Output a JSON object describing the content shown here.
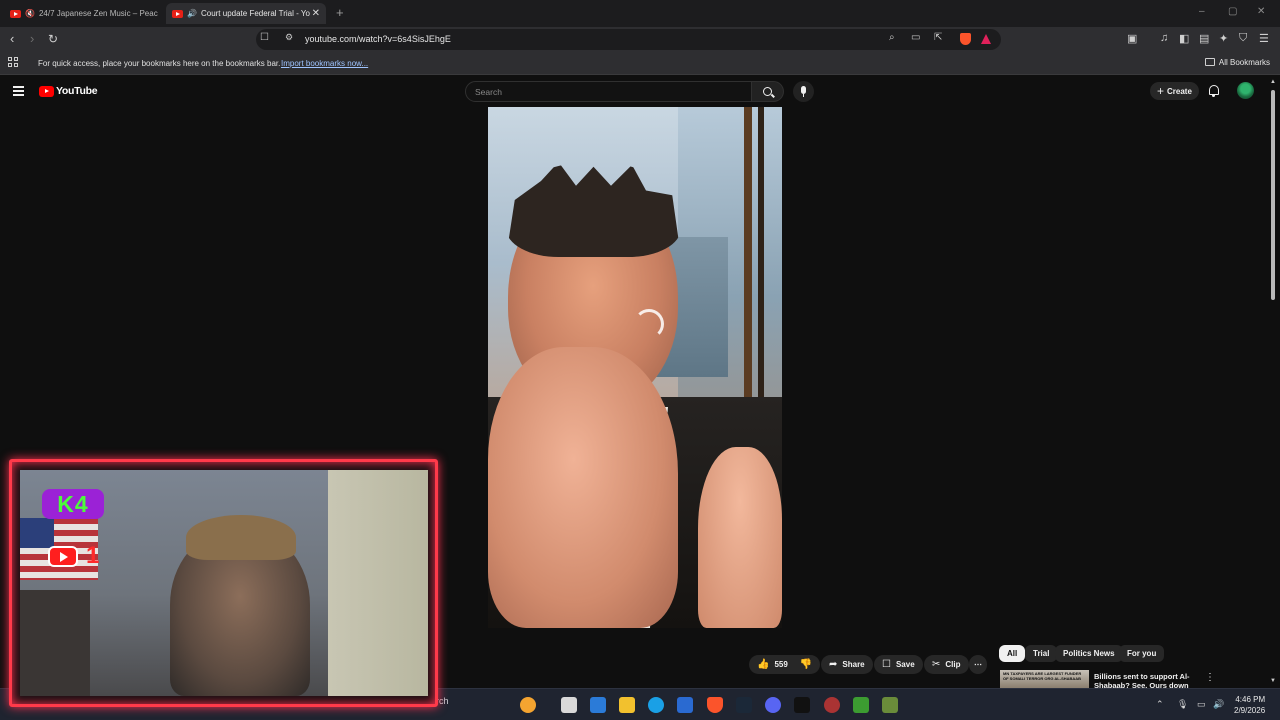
{
  "browser": {
    "tabs": [
      {
        "title": "24/7 Japanese Zen Music – Peace"
      },
      {
        "title": "Court update Federal Trial - Yo"
      }
    ],
    "new_tab_label": "+",
    "window_controls": {
      "minimize": "–",
      "restore": "▢",
      "close": "✕"
    },
    "url": "youtube.com/watch?v=6s4SisJEhgE",
    "bookmarks_prompt": "For quick access, place your bookmarks here on the bookmarks bar.",
    "bookmarks_import_link": "Import bookmarks now...",
    "all_bookmarks": "All Bookmarks"
  },
  "youtube": {
    "logo": "YouTube",
    "search_placeholder": "Search",
    "create_label": "Create",
    "actions": {
      "likes": "559",
      "share": "Share",
      "save": "Save",
      "clip": "Clip",
      "more": "⋯"
    },
    "chips": [
      "All",
      "Trial",
      "Politics News",
      "For you"
    ],
    "active_chip": "All",
    "recommendation": {
      "thumb_text": "MN TAXPAYERS ARE LARGEST FUNDER OF SOMALI TERROR ORG AL-SHABAAB",
      "title": "Billions sent to support Al-Shabaab? See. Ours down"
    }
  },
  "webcam_overlay": {
    "logo_text": "K4",
    "subscriber_mark": "1"
  },
  "taskbar": {
    "search_label": "Search",
    "time": "4:46 PM",
    "date": "2/9/2026"
  },
  "colors": {
    "youtube_red": "#ff0000",
    "overlay_border": "#ff3a4a",
    "k4_bg": "#9b22d6",
    "k4_text": "#4dfc3a"
  }
}
